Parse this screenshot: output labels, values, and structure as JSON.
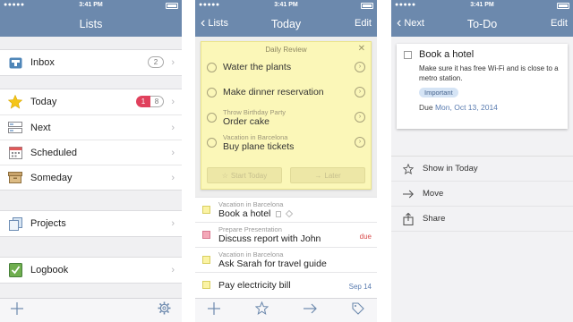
{
  "status": {
    "signal": "●●●●● ",
    "time": "3:41 PM"
  },
  "screen1": {
    "title": "Lists",
    "inbox": {
      "label": "Inbox",
      "count": "2"
    },
    "today": {
      "label": "Today",
      "due_count": "1",
      "count": "8"
    },
    "next": {
      "label": "Next"
    },
    "scheduled": {
      "label": "Scheduled"
    },
    "someday": {
      "label": "Someday"
    },
    "projects": {
      "label": "Projects"
    },
    "logbook": {
      "label": "Logbook"
    },
    "toolbar": {
      "add_icon": "plus-icon",
      "settings_icon": "gear-icon"
    }
  },
  "screen2": {
    "back": "Lists",
    "title": "Today",
    "edit": "Edit",
    "review": {
      "title": "Daily Review",
      "items": [
        {
          "subtitle": "",
          "label": "Water the plants"
        },
        {
          "subtitle": "",
          "label": "Make dinner reservation"
        },
        {
          "subtitle": "Throw Birthday Party",
          "label": "Order cake"
        },
        {
          "subtitle": "Vacation in Barcelona",
          "label": "Buy plane tickets"
        }
      ],
      "start_today": "Start Today",
      "later": "Later"
    },
    "tasks": [
      {
        "subtitle": "Vacation in Barcelona",
        "label": "Book a hotel",
        "meta": ""
      },
      {
        "subtitle": "Prepare Presentation",
        "label": "Discuss report with John",
        "meta": "due"
      },
      {
        "subtitle": "Vacation in Barcelona",
        "label": "Ask Sarah for travel guide",
        "meta": ""
      },
      {
        "subtitle": "",
        "label": "Pay electricity bill",
        "meta": "Sep 14"
      }
    ]
  },
  "screen3": {
    "back": "Next",
    "title": "To-Do",
    "edit": "Edit",
    "todo": {
      "title": "Book a hotel",
      "notes": "Make sure it has free Wi-Fi and is close to a metro station.",
      "tag": "Important",
      "due_label": "Due",
      "due_date": "Mon, Oct 13, 2014"
    },
    "actions": [
      {
        "label": "Show in Today",
        "icon": "star-icon"
      },
      {
        "label": "Move",
        "icon": "arrow-right-icon"
      },
      {
        "label": "Share",
        "icon": "share-icon"
      }
    ]
  },
  "colors": {
    "nav": "#6c89ad",
    "due": "#d94b4b",
    "date": "#5a7cb0",
    "review_bg": "#fbf7b8"
  }
}
